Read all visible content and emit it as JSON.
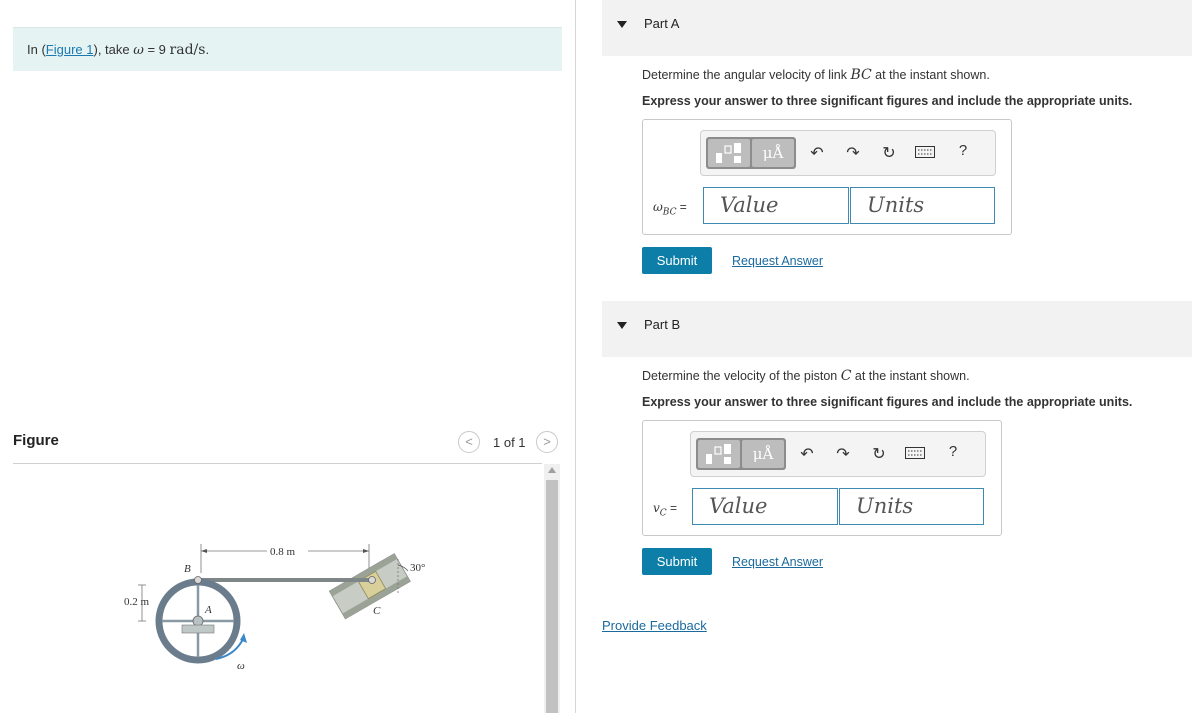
{
  "intro": {
    "prefix": "In (",
    "figure_link": "Figure 1",
    "middle": "), take ",
    "omega": "ω",
    "equals": " = 9 ",
    "units": "rad/s",
    "suffix": "."
  },
  "figure_panel": {
    "label": "Figure",
    "page_count": "1 of 1",
    "prev_icon": "chevron-left-icon",
    "next_icon": "chevron-right-icon",
    "labels": {
      "length": "0.8 m",
      "radius": "0.2 m",
      "angle": "30°",
      "point_b": "B",
      "point_a": "A",
      "point_c": "C",
      "omega": "ω"
    }
  },
  "part_a": {
    "title": "Part A",
    "question_prefix": "Determine the angular velocity of link ",
    "question_var": "BC",
    "question_suffix": " at the instant shown.",
    "instruction": "Express your answer to three significant figures and include the appropriate units.",
    "var_symbol": "ω",
    "var_sub": "BC",
    "equals": " =",
    "value_placeholder": "Value",
    "units_placeholder": "Units",
    "submit_label": "Submit",
    "request_label": "Request Answer"
  },
  "part_b": {
    "title": "Part B",
    "question_prefix": "Determine the velocity of the piston ",
    "question_var": "C",
    "question_suffix": " at the instant shown.",
    "instruction": "Express your answer to three significant figures and include the appropriate units.",
    "var_symbol": "v",
    "var_sub": "C",
    "equals": " =",
    "value_placeholder": "Value",
    "units_placeholder": "Units",
    "submit_label": "Submit",
    "request_label": "Request Answer"
  },
  "toolbar": {
    "units_label": "μÅ",
    "help_label": "?",
    "icons": [
      "templates-icon",
      "units-icon",
      "undo-icon",
      "redo-icon",
      "reset-icon",
      "keyboard-icon",
      "help-icon"
    ]
  },
  "feedback_label": "Provide Feedback",
  "colors": {
    "accent": "#0d7ea8",
    "link": "#1a6a9e",
    "intro_bg": "#e6f3f3",
    "header_bg": "#f2f2f2"
  }
}
